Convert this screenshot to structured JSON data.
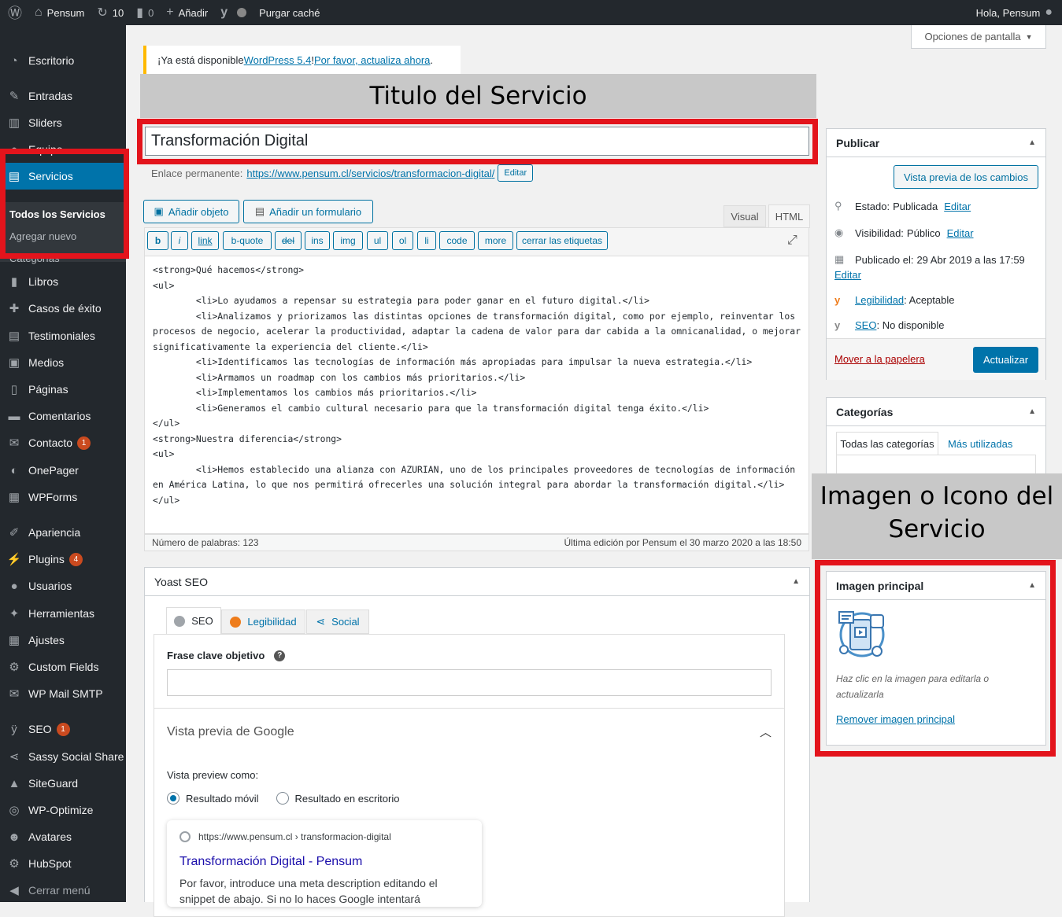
{
  "admin_bar": {
    "site_name": "Pensum",
    "updates": "10",
    "comments": "0",
    "add_new": "Añadir",
    "purge": "Purgar caché",
    "greeting": "Hola, Pensum"
  },
  "sidebar": {
    "items": [
      {
        "label": "Escritorio",
        "icon": "dashboard-icon"
      },
      {
        "label": "Entradas",
        "icon": "pin-icon"
      },
      {
        "label": "Sliders",
        "icon": "slider-icon"
      },
      {
        "label": "Equipo",
        "icon": "team-icon"
      },
      {
        "label": "Servicios",
        "icon": "services-icon"
      },
      {
        "label": "Libros",
        "icon": "book-icon"
      },
      {
        "label": "Casos de éxito",
        "icon": "graduation-icon"
      },
      {
        "label": "Testimoniales",
        "icon": "testimonial-icon"
      },
      {
        "label": "Medios",
        "icon": "media-icon"
      },
      {
        "label": "Páginas",
        "icon": "page-icon"
      },
      {
        "label": "Comentarios",
        "icon": "comment-icon"
      },
      {
        "label": "Contacto",
        "icon": "mail-icon",
        "badge": "1"
      },
      {
        "label": "OnePager",
        "icon": "onepager-icon"
      },
      {
        "label": "WPForms",
        "icon": "form-icon"
      },
      {
        "label": "Apariencia",
        "icon": "brush-icon"
      },
      {
        "label": "Plugins",
        "icon": "plugin-icon",
        "badge": "4"
      },
      {
        "label": "Usuarios",
        "icon": "user-icon"
      },
      {
        "label": "Herramientas",
        "icon": "wrench-icon"
      },
      {
        "label": "Ajustes",
        "icon": "settings-icon"
      },
      {
        "label": "Custom Fields",
        "icon": "gear-icon"
      },
      {
        "label": "WP Mail SMTP",
        "icon": "envelope-icon"
      },
      {
        "label": "SEO",
        "icon": "yoast-icon",
        "badge": "1"
      },
      {
        "label": "Sassy Social Share",
        "icon": "share-icon"
      },
      {
        "label": "SiteGuard",
        "icon": "shield-icon"
      },
      {
        "label": "WP-Optimize",
        "icon": "optimize-icon"
      },
      {
        "label": "Avatares",
        "icon": "avatar-icon"
      },
      {
        "label": "HubSpot",
        "icon": "hubspot-icon"
      },
      {
        "label": "Cerrar menú",
        "icon": "collapse-icon"
      }
    ],
    "submenu": [
      "Todos los Servicios",
      "Agregar nuevo",
      "Categorías"
    ]
  },
  "screen_options": "Opciones de pantalla",
  "notice": {
    "pre": "¡Ya está disponible ",
    "link1": "WordPress 5.4",
    "mid": "! ",
    "link2": "Por favor, actualiza ahora",
    "post": "."
  },
  "labels": {
    "title": "Titulo del Servicio",
    "image": "Imagen o Icono del Servicio"
  },
  "editor": {
    "title_value": "Transformación Digital",
    "permalink_label": "Enlace permanente:",
    "permalink_pre": "https://www.pensum.cl/servicios/",
    "permalink_slug": "transformacion-digital",
    "permalink_post": "/",
    "edit": "Editar",
    "add_object": "Añadir objeto",
    "add_form": "Añadir un formulario",
    "tab_visual": "Visual",
    "tab_html": "HTML",
    "quicktags": [
      "b",
      "i",
      "link",
      "b-quote",
      "del",
      "ins",
      "img",
      "ul",
      "ol",
      "li",
      "code",
      "more",
      "cerrar las etiquetas"
    ],
    "content": "<strong>Qué hacemos</strong>\n<ul>\n\t<li>Lo ayudamos a repensar su estrategia para poder ganar en el futuro digital.</li>\n\t<li>Analizamos y priorizamos las distintas opciones de transformación digital, como por ejemplo, reinventar los procesos de negocio, acelerar la productividad, adaptar la cadena de valor para dar cabida a la omnicanalidad, o mejorar significativamente la experiencia del cliente.</li>\n\t<li>Identificamos las tecnologías de información más apropiadas para impulsar la nueva estrategia.</li>\n\t<li>Armamos un roadmap con los cambios más prioritarios.</li>\n\t<li>Implementamos los cambios más prioritarios.</li>\n\t<li>Generamos el cambio cultural necesario para que la transformación digital tenga éxito.</li>\n</ul>\n<strong>Nuestra diferencia</strong>\n<ul>\n\t<li>Hemos establecido una alianza con AZURIAN, uno de los principales proveedores de tecnologías de información en América Latina, lo que nos permitirá ofrecerles una solución integral para abordar la transformación digital.</li>\n</ul>",
    "word_count": "Número de palabras: 123",
    "last_edit": "Última edición por Pensum el 30 marzo 2020 a las 18:50"
  },
  "yoast": {
    "title": "Yoast SEO",
    "tabs": [
      "SEO",
      "Legibilidad",
      "Social"
    ],
    "keyphrase_label": "Frase clave objetivo",
    "google_preview": "Vista previa de Google",
    "preview_as": "Vista preview como:",
    "opt_mobile": "Resultado móvil",
    "opt_desktop": "Resultado en escritorio",
    "snippet_url": "https://www.pensum.cl › transformacion-digital",
    "snippet_title": "Transformación Digital - Pensum",
    "snippet_desc": "Por favor, introduce una meta description editando el snippet de abajo. Si no lo haces Google intentará"
  },
  "publish": {
    "title": "Publicar",
    "preview": "Vista previa de los cambios",
    "status_label": "Estado:",
    "status": "Publicada",
    "visibility_label": "Visibilidad:",
    "visibility": "Público",
    "published_label": "Publicado el:",
    "published": "29 Abr 2019 a las 17:59",
    "edit": "Editar",
    "readability_link": "Legibilidad",
    "readability": ": Aceptable",
    "seo_link": "SEO",
    "seo": ": No disponible",
    "trash": "Mover a la papelera",
    "update": "Actualizar"
  },
  "categories": {
    "title": "Categorías",
    "tab_all": "Todas las categorías",
    "tab_used": "Más utilizadas"
  },
  "featured": {
    "title": "Imagen principal",
    "hint": "Haz clic en la imagen para editarla o actualizarla",
    "remove": "Remover imagen principal"
  },
  "colors": {
    "accent": "#0073aa",
    "highlight": "#e3141c",
    "sidebar_bg": "#23282d"
  }
}
